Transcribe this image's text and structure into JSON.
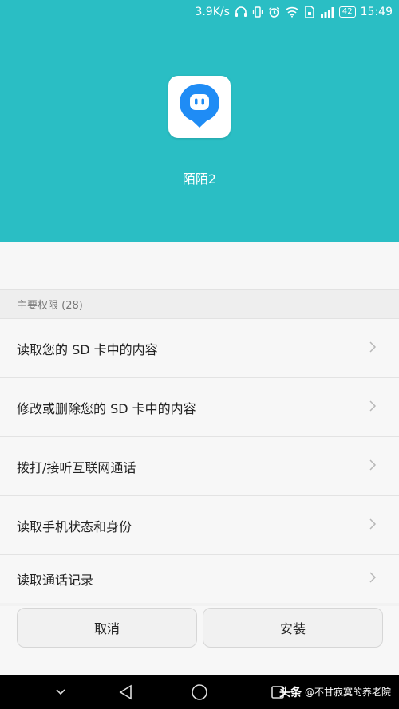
{
  "status_bar": {
    "network_speed": "3.9K/s",
    "battery_level": "42",
    "time": "15:49",
    "icons": [
      "headphones-icon",
      "vibrate-icon",
      "alarm-icon",
      "wifi-icon",
      "sim-icon",
      "signal-icon",
      "battery-icon"
    ]
  },
  "app": {
    "name": "陌陌2",
    "icon": "momo-chat-bubble-icon",
    "brand_color": "#2abec4",
    "icon_color": "#1f8cf5"
  },
  "permissions": {
    "section_title": "主要权限 (28)",
    "items": [
      {
        "label": "读取您的 SD 卡中的内容"
      },
      {
        "label": "修改或删除您的 SD 卡中的内容"
      },
      {
        "label": "拨打/接听互联网通话"
      },
      {
        "label": "读取手机状态和身份"
      },
      {
        "label": "读取通话记录"
      }
    ]
  },
  "actions": {
    "cancel_label": "取消",
    "install_label": "安装"
  },
  "nav_bar": {
    "icons": [
      "chevron-down-icon",
      "back-icon",
      "home-icon",
      "recents-icon"
    ]
  },
  "watermark": {
    "brand": "头条",
    "handle": "@不甘寂寞的养老院"
  }
}
